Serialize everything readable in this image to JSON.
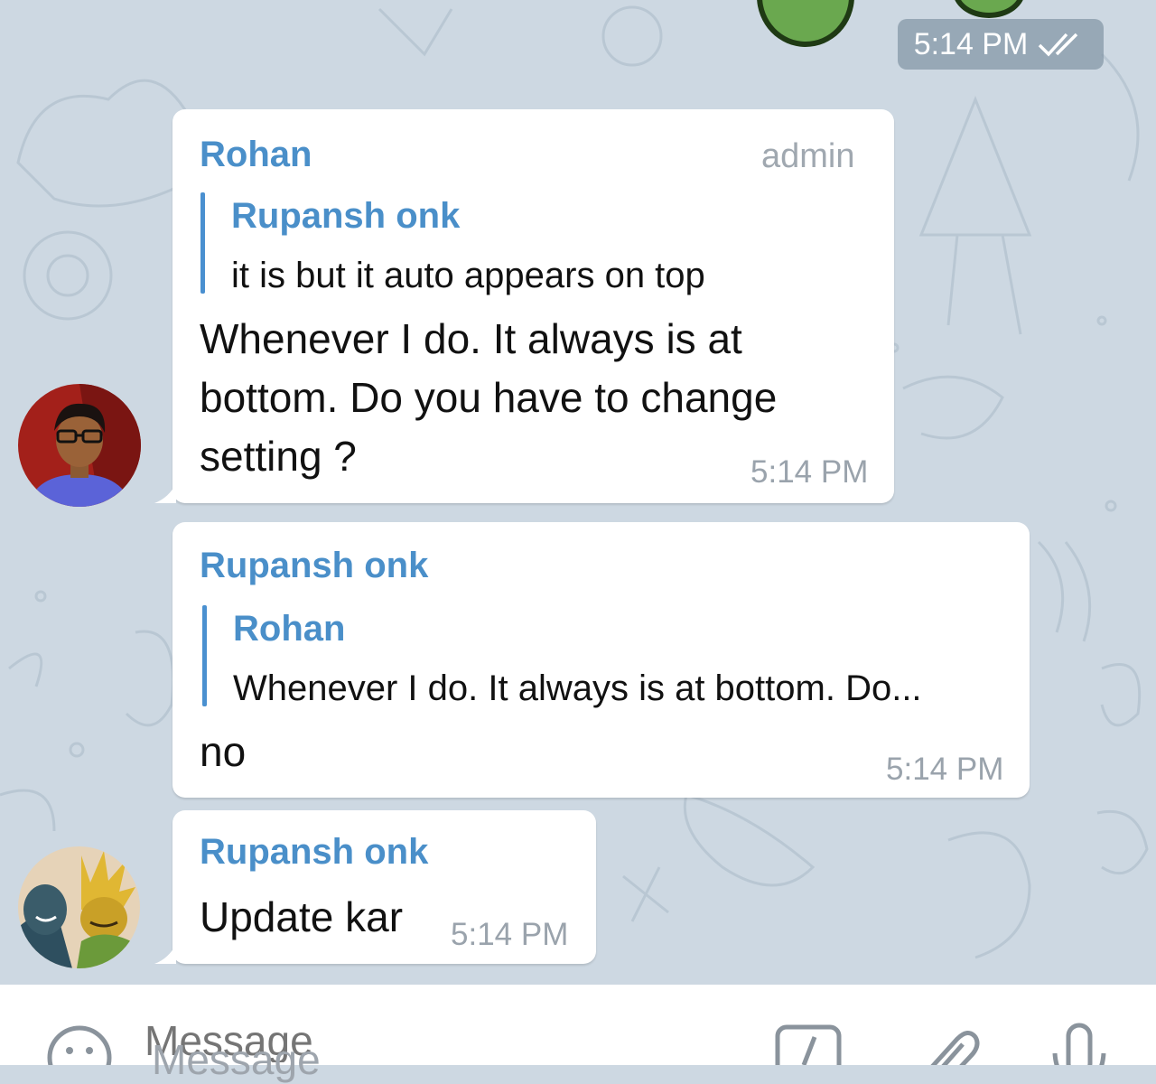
{
  "top_sticker": {
    "time": "5:14 PM",
    "status_icon": "double-check-icon"
  },
  "messages": [
    {
      "sender": "Rohan",
      "role": "admin",
      "reply": {
        "name": "Rupansh onk",
        "text": "it is but it auto appears on top"
      },
      "lines": [
        "Whenever I do. It always is at",
        "bottom. Do you have to change",
        "setting ?"
      ],
      "time": "5:14 PM"
    },
    {
      "sender": "Rupansh onk",
      "reply": {
        "name": "Rohan",
        "text": "Whenever I do. It always is at bottom. Do..."
      },
      "text": "no",
      "time": "5:14 PM"
    },
    {
      "sender": "Rupansh onk",
      "text": "Update kar",
      "time": "5:14 PM"
    }
  ],
  "composer": {
    "placeholder": "Message",
    "icons": [
      "emoji-icon",
      "bot-command-icon",
      "attach-icon",
      "microphone-icon"
    ]
  },
  "colors": {
    "background": "#cdd8e2",
    "accent": "#4a8fc9",
    "bubble": "#ffffff"
  }
}
